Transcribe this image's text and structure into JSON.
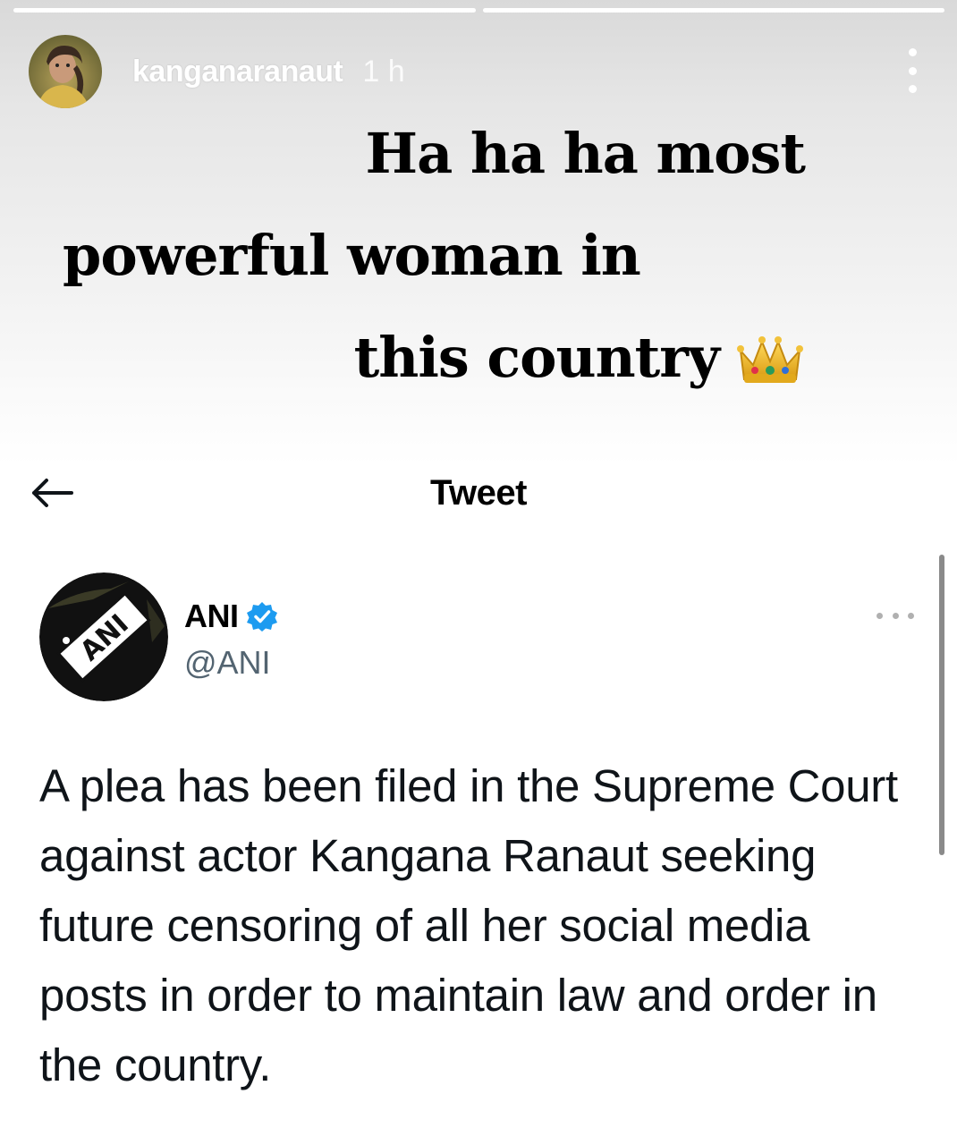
{
  "story": {
    "progress": [
      1.0,
      1.0
    ],
    "username": "kanganaranaut",
    "time": "1 h",
    "caption": {
      "line1": "Ha ha ha most",
      "line2": "powerful woman in",
      "line3": "this country"
    },
    "emoji": "crown-icon"
  },
  "tweet": {
    "header_title": "Tweet",
    "author": {
      "name": "ANI",
      "handle": "@ANI",
      "verified": true,
      "avatar_text": "ANI"
    },
    "text": "A plea has been filed in the Supreme Court against actor Kangana Ranaut seeking future censoring of all her social media posts in order to maintain law and order in the country."
  },
  "colors": {
    "verified_blue": "#1d9bf0",
    "handle_gray": "#536471",
    "text": "#0f1419"
  }
}
